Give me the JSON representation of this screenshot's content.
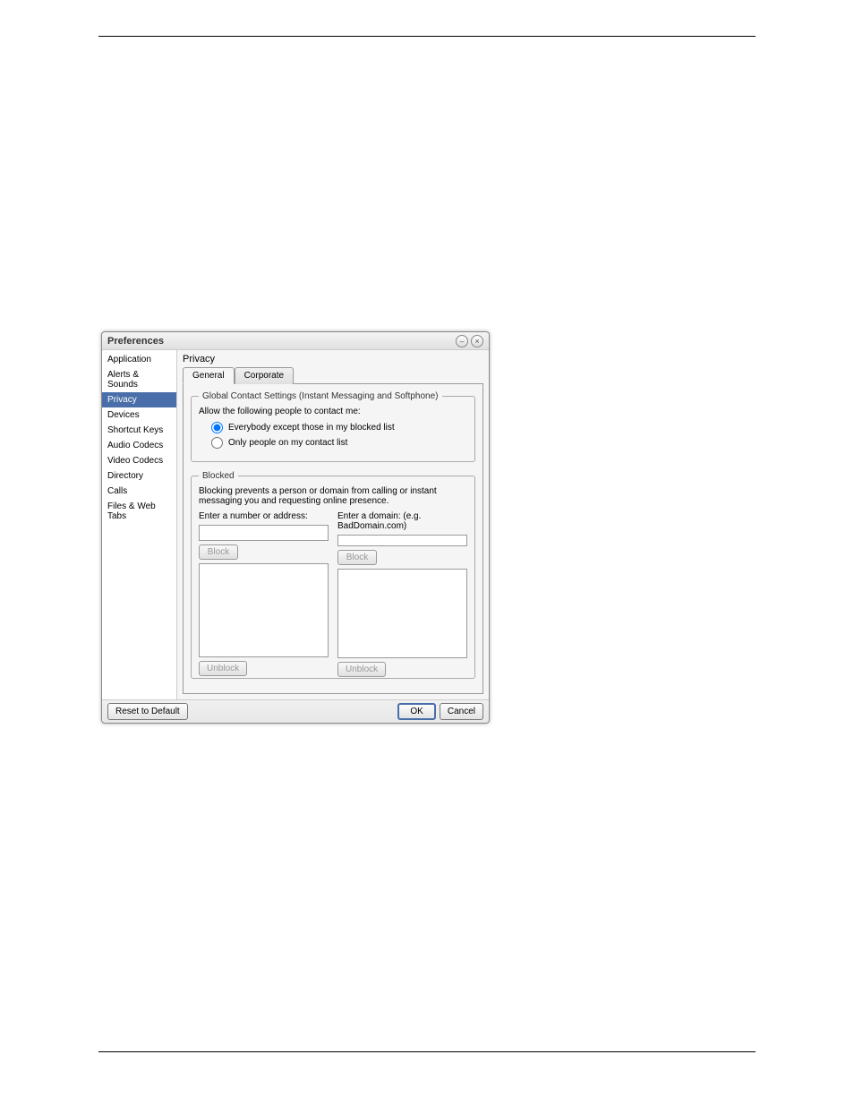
{
  "dialog": {
    "title": "Preferences"
  },
  "sidebar": {
    "items": [
      {
        "label": "Application"
      },
      {
        "label": "Alerts & Sounds"
      },
      {
        "label": "Privacy"
      },
      {
        "label": "Devices"
      },
      {
        "label": "Shortcut Keys"
      },
      {
        "label": "Audio Codecs"
      },
      {
        "label": "Video Codecs"
      },
      {
        "label": "Directory"
      },
      {
        "label": "Calls"
      },
      {
        "label": "Files & Web Tabs"
      }
    ],
    "selected_index": 2
  },
  "panel": {
    "heading": "Privacy",
    "tabs": [
      {
        "label": "General"
      },
      {
        "label": "Corporate"
      }
    ],
    "active_tab": 0
  },
  "global_contact": {
    "legend": "Global Contact Settings (Instant Messaging and Softphone)",
    "prompt": "Allow the following people to contact me:",
    "option1": "Everybody except those in my blocked list",
    "option2": "Only people on my contact list",
    "selected": "option1"
  },
  "blocked": {
    "legend": "Blocked",
    "description": "Blocking prevents a person or domain from calling or instant messaging you and requesting online presence.",
    "number_label": "Enter a number or address:",
    "domain_label": "Enter a domain: (e.g. BadDomain.com)",
    "block_btn": "Block",
    "unblock_btn": "Unblock"
  },
  "buttons": {
    "reset": "Reset to Default",
    "ok": "OK",
    "cancel": "Cancel"
  }
}
